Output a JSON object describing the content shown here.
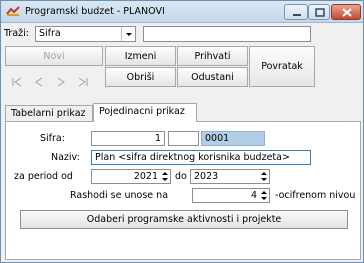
{
  "window": {
    "title": "Programski budzet - PLANOVI"
  },
  "search": {
    "label": "Traži:",
    "field_value": "Sifra",
    "text_value": ""
  },
  "toolbar": {
    "novi": "Novi",
    "izmeni": "Izmeni",
    "prihvati": "Prihvati",
    "obrisi": "Obriši",
    "odustani": "Odustani",
    "povratak": "Povratak"
  },
  "tabs": [
    {
      "label": "Tabelarni prikaz"
    },
    {
      "label": "Pojedinacni prikaz"
    }
  ],
  "form": {
    "sifra_label": "Sifra:",
    "sifra_value": "1",
    "sifra_code": "0001",
    "naziv_label": "Naziv:",
    "naziv_value": "Plan <sifra direktnog korisnika budzeta>",
    "period_label": "za period od",
    "period_from": "2021",
    "period_do_label": "do",
    "period_to": "2023",
    "rashodi_label": "Rashodi se unose na",
    "rashodi_value": "4",
    "rashodi_suffix": "-ocifrenom nivou",
    "action_button": "Odaberi programske aktivnosti i projekte"
  },
  "icons": [
    "window-app-icon",
    "minimize-icon",
    "maximize-icon",
    "close-icon",
    "dropdown-arrow-icon",
    "first-record-icon",
    "previous-record-icon",
    "next-record-icon",
    "last-record-icon",
    "spin-up-down-icon"
  ]
}
